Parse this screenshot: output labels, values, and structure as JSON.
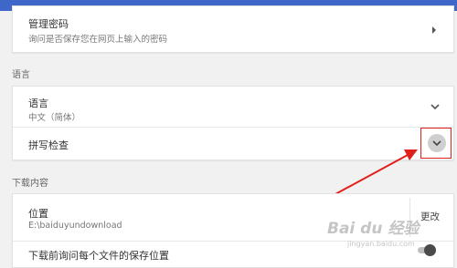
{
  "passwords": {
    "manage_title": "管理密码",
    "manage_desc": "询问是否保存您在网页上输入的密码"
  },
  "language_section": {
    "label": "语言",
    "language_title": "语言",
    "language_value": "中文（简体）",
    "spellcheck_label": "拼写检查"
  },
  "downloads_section": {
    "label": "下载内容",
    "location_title": "位置",
    "location_value": "E:\\baiduyundownload",
    "change_label": "更改",
    "ask_where_label": "下载前询问每个文件的保存位置"
  },
  "watermark": {
    "brand": "Bai du 经验",
    "url": "jingyan.baidu.com"
  },
  "colors": {
    "accent_blue": "#3f66c9",
    "annotation_red": "#e0201b"
  },
  "states": {
    "ask_where_toggle_on": false
  },
  "icons": [
    "chevron-right-icon",
    "chevron-down-icon",
    "expand-icon",
    "arrow-annotation"
  ]
}
